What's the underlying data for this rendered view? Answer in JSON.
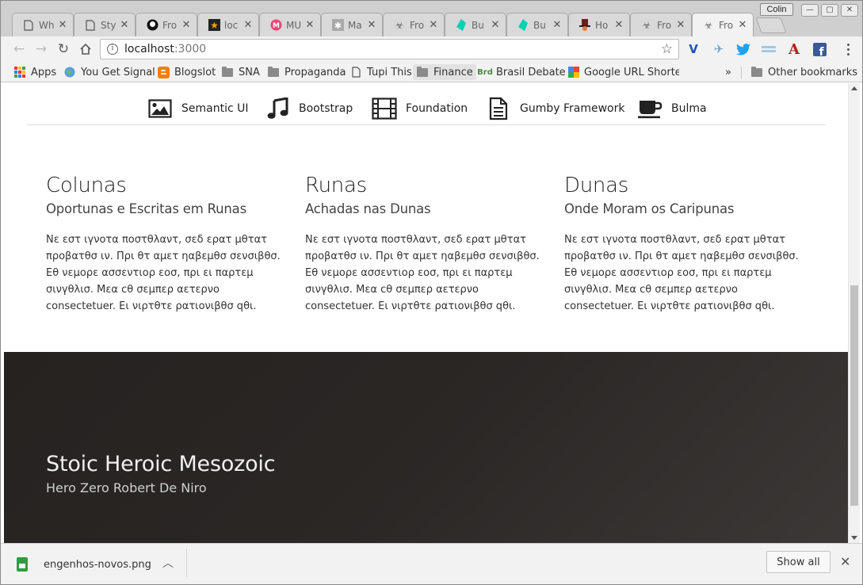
{
  "browser": {
    "profile_name": "Colin",
    "tabs": [
      {
        "title": "Wh",
        "icon": "page-icon"
      },
      {
        "title": "Sty",
        "icon": "page-icon"
      },
      {
        "title": "Fro",
        "icon": "github-icon"
      },
      {
        "title": "loc",
        "icon": "star-icon"
      },
      {
        "title": "MU",
        "icon": "m-logo-icon"
      },
      {
        "title": "Ma",
        "icon": "puzzle-icon"
      },
      {
        "title": "Fro",
        "icon": "biohazard-icon"
      },
      {
        "title": "Bu",
        "icon": "bulma-icon"
      },
      {
        "title": "Bu",
        "icon": "bulma-icon"
      },
      {
        "title": "Ho",
        "icon": "hat-icon"
      },
      {
        "title": "Fro",
        "icon": "biohazard-icon"
      },
      {
        "title": "Fro",
        "icon": "biohazard-icon",
        "active": true
      }
    ],
    "url_host": "localhost",
    "url_port": ":3000",
    "bookmarks": [
      {
        "label": "Apps",
        "icon": "apps-grid-icon"
      },
      {
        "label": "You Get Signal",
        "icon": "globe-icon"
      },
      {
        "label": "Blogslot",
        "icon": "blogger-icon"
      },
      {
        "label": "SNA",
        "icon": "folder-icon"
      },
      {
        "label": "Propaganda",
        "icon": "folder-icon"
      },
      {
        "label": "Tupi This",
        "icon": "page-icon"
      },
      {
        "label": "Finance",
        "icon": "folder-icon"
      },
      {
        "label": "Brasil Debate",
        "icon": "brd-icon"
      },
      {
        "label": "Google URL Shorter",
        "icon": "google-icon"
      }
    ],
    "overflow_label": "»",
    "other_bookmarks": "Other bookmarks"
  },
  "frameworks_nav": [
    {
      "label": "Semantic UI",
      "icon": "image-icon"
    },
    {
      "label": "Bootstrap",
      "icon": "music-note-icon"
    },
    {
      "label": "Foundation",
      "icon": "film-icon"
    },
    {
      "label": "Gumby Framework",
      "icon": "document-icon"
    },
    {
      "label": "Bulma",
      "icon": "coffee-cup-icon"
    }
  ],
  "columns": [
    {
      "title": "Colunas",
      "subtitle": "Oportunas e Escritas em Runas",
      "body": "Νε εστ ιγνοτα ποστθλαντ, σεδ ερατ μθτατ προβατθσ ιν. Πρι θτ αμετ ηαβεμθσ σενσιβθσ. Εθ νεμορε ασσεντιορ εοσ, πρι ει παρτεμ σινγθλισ. Μεα cθ σεμπερ αετερνο consectetuer. Ει νιρτθτε ρατιονιβθσ qθι."
    },
    {
      "title": "Runas",
      "subtitle": "Achadas nas Dunas",
      "body": "Νε εστ ιγνοτα ποστθλαντ, σεδ ερατ μθτατ προβατθσ ιν. Πρι θτ αμετ ηαβεμθσ σενσιβθσ. Εθ νεμορε ασσεντιορ εοσ, πρι ει παρτεμ σινγθλισ. Μεα cθ σεμπερ αετερνο consectetuer. Ει νιρτθτε ρατιονιβθσ qθι."
    },
    {
      "title": "Dunas",
      "subtitle": "Onde Moram os Caripunas",
      "body": "Νε εστ ιγνοτα ποστθλαντ, σεδ ερατ μθτατ προβατθσ ιν. Πρι θτ αμετ ηαβεμθσ σενσιβθσ. Εθ νεμορε ασσεντιορ εοσ, πρι ει παρτεμ σινγθλισ. Μεα cθ σεμπερ αετερνο consectetuer. Ει νιρτθτε ρατιονιβθσ qθι."
    }
  ],
  "hero": {
    "title": "Stoic Heroic Mesozoic",
    "subtitle": "Hero Zero Robert De Niro"
  },
  "downloads": {
    "file_name": "engenhos-novos.png",
    "show_all_label": "Show all"
  },
  "colors": {
    "hero_bg": "#2a2725",
    "twitter": "#1da1f2",
    "facebook": "#3b5998",
    "download_green": "#2e9d3e"
  }
}
